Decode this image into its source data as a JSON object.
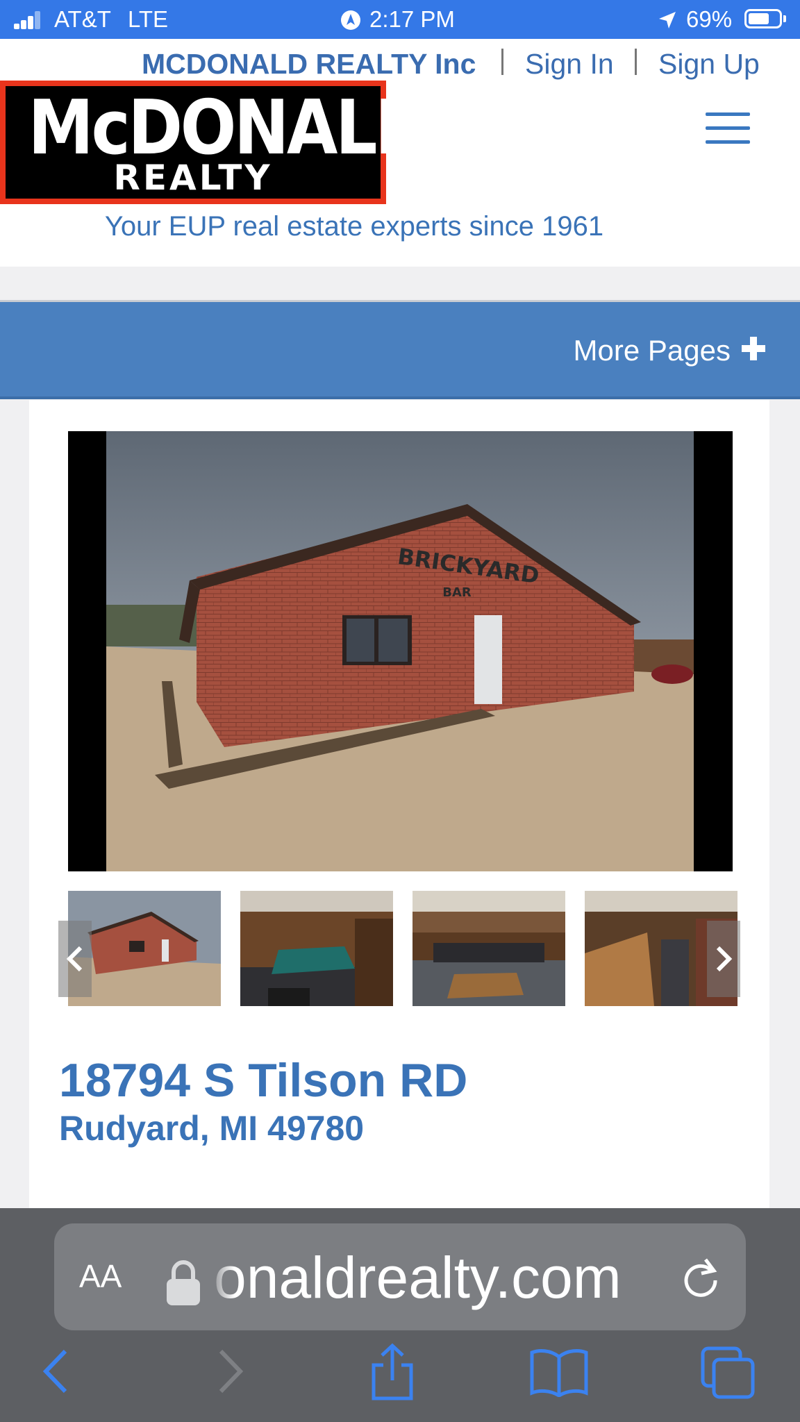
{
  "status_bar": {
    "carrier": "AT&T",
    "network": "LTE",
    "time": "2:17 PM",
    "battery": "69%",
    "battery_level": 0.69
  },
  "header": {
    "company_link": "MCDONALD REALTY Inc",
    "sign_in": "Sign In",
    "sign_up": "Sign Up",
    "logo_line1": "McDONALD",
    "logo_line2": "REALTY",
    "tagline": "Your EUP real estate experts since 1961"
  },
  "nav": {
    "more_pages": "More Pages"
  },
  "listing": {
    "sign_text_1": "BRICKYARD",
    "sign_text_2": "BAR",
    "address_line1": "18794 S Tilson RD",
    "address_line2": "Rudyard, MI 49780",
    "thumbnails": [
      "exterior",
      "pool-table-room",
      "bar-stools",
      "bar-counter"
    ]
  },
  "browser": {
    "text_size_label": "AA",
    "url": "onaldrealty.com"
  },
  "colors": {
    "status_bar": "#3478e7",
    "brand_blue": "#3a73b7",
    "nav_bar": "#4a80bf",
    "logo_red": "#e8341c",
    "safari_bg": "#5d5f63"
  },
  "icons": [
    "signal-icon",
    "location-arrow-icon",
    "battery-icon",
    "hamburger-menu-icon",
    "plus-icon",
    "chevron-left-icon",
    "chevron-right-icon",
    "lock-icon",
    "reload-icon",
    "back-icon",
    "forward-icon",
    "share-icon",
    "bookmarks-icon",
    "tabs-icon"
  ]
}
